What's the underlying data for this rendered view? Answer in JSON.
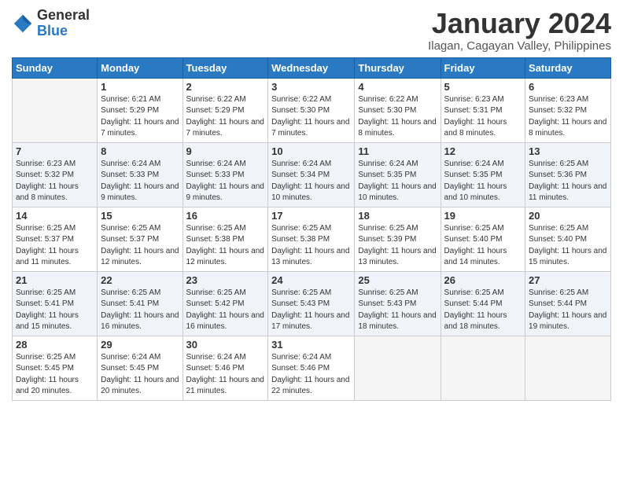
{
  "logo": {
    "general": "General",
    "blue": "Blue"
  },
  "header": {
    "month": "January 2024",
    "location": "Ilagan, Cagayan Valley, Philippines"
  },
  "weekdays": [
    "Sunday",
    "Monday",
    "Tuesday",
    "Wednesday",
    "Thursday",
    "Friday",
    "Saturday"
  ],
  "weeks": [
    [
      {
        "day": "",
        "empty": true
      },
      {
        "day": "1",
        "sunrise": "6:21 AM",
        "sunset": "5:29 PM",
        "daylight": "11 hours and 7 minutes."
      },
      {
        "day": "2",
        "sunrise": "6:22 AM",
        "sunset": "5:29 PM",
        "daylight": "11 hours and 7 minutes."
      },
      {
        "day": "3",
        "sunrise": "6:22 AM",
        "sunset": "5:30 PM",
        "daylight": "11 hours and 7 minutes."
      },
      {
        "day": "4",
        "sunrise": "6:22 AM",
        "sunset": "5:30 PM",
        "daylight": "11 hours and 8 minutes."
      },
      {
        "day": "5",
        "sunrise": "6:23 AM",
        "sunset": "5:31 PM",
        "daylight": "11 hours and 8 minutes."
      },
      {
        "day": "6",
        "sunrise": "6:23 AM",
        "sunset": "5:32 PM",
        "daylight": "11 hours and 8 minutes."
      }
    ],
    [
      {
        "day": "7",
        "sunrise": "6:23 AM",
        "sunset": "5:32 PM",
        "daylight": "11 hours and 8 minutes."
      },
      {
        "day": "8",
        "sunrise": "6:24 AM",
        "sunset": "5:33 PM",
        "daylight": "11 hours and 9 minutes."
      },
      {
        "day": "9",
        "sunrise": "6:24 AM",
        "sunset": "5:33 PM",
        "daylight": "11 hours and 9 minutes."
      },
      {
        "day": "10",
        "sunrise": "6:24 AM",
        "sunset": "5:34 PM",
        "daylight": "11 hours and 10 minutes."
      },
      {
        "day": "11",
        "sunrise": "6:24 AM",
        "sunset": "5:35 PM",
        "daylight": "11 hours and 10 minutes."
      },
      {
        "day": "12",
        "sunrise": "6:24 AM",
        "sunset": "5:35 PM",
        "daylight": "11 hours and 10 minutes."
      },
      {
        "day": "13",
        "sunrise": "6:25 AM",
        "sunset": "5:36 PM",
        "daylight": "11 hours and 11 minutes."
      }
    ],
    [
      {
        "day": "14",
        "sunrise": "6:25 AM",
        "sunset": "5:37 PM",
        "daylight": "11 hours and 11 minutes."
      },
      {
        "day": "15",
        "sunrise": "6:25 AM",
        "sunset": "5:37 PM",
        "daylight": "11 hours and 12 minutes."
      },
      {
        "day": "16",
        "sunrise": "6:25 AM",
        "sunset": "5:38 PM",
        "daylight": "11 hours and 12 minutes."
      },
      {
        "day": "17",
        "sunrise": "6:25 AM",
        "sunset": "5:38 PM",
        "daylight": "11 hours and 13 minutes."
      },
      {
        "day": "18",
        "sunrise": "6:25 AM",
        "sunset": "5:39 PM",
        "daylight": "11 hours and 13 minutes."
      },
      {
        "day": "19",
        "sunrise": "6:25 AM",
        "sunset": "5:40 PM",
        "daylight": "11 hours and 14 minutes."
      },
      {
        "day": "20",
        "sunrise": "6:25 AM",
        "sunset": "5:40 PM",
        "daylight": "11 hours and 15 minutes."
      }
    ],
    [
      {
        "day": "21",
        "sunrise": "6:25 AM",
        "sunset": "5:41 PM",
        "daylight": "11 hours and 15 minutes."
      },
      {
        "day": "22",
        "sunrise": "6:25 AM",
        "sunset": "5:41 PM",
        "daylight": "11 hours and 16 minutes."
      },
      {
        "day": "23",
        "sunrise": "6:25 AM",
        "sunset": "5:42 PM",
        "daylight": "11 hours and 16 minutes."
      },
      {
        "day": "24",
        "sunrise": "6:25 AM",
        "sunset": "5:43 PM",
        "daylight": "11 hours and 17 minutes."
      },
      {
        "day": "25",
        "sunrise": "6:25 AM",
        "sunset": "5:43 PM",
        "daylight": "11 hours and 18 minutes."
      },
      {
        "day": "26",
        "sunrise": "6:25 AM",
        "sunset": "5:44 PM",
        "daylight": "11 hours and 18 minutes."
      },
      {
        "day": "27",
        "sunrise": "6:25 AM",
        "sunset": "5:44 PM",
        "daylight": "11 hours and 19 minutes."
      }
    ],
    [
      {
        "day": "28",
        "sunrise": "6:25 AM",
        "sunset": "5:45 PM",
        "daylight": "11 hours and 20 minutes."
      },
      {
        "day": "29",
        "sunrise": "6:24 AM",
        "sunset": "5:45 PM",
        "daylight": "11 hours and 20 minutes."
      },
      {
        "day": "30",
        "sunrise": "6:24 AM",
        "sunset": "5:46 PM",
        "daylight": "11 hours and 21 minutes."
      },
      {
        "day": "31",
        "sunrise": "6:24 AM",
        "sunset": "5:46 PM",
        "daylight": "11 hours and 22 minutes."
      },
      {
        "day": "",
        "empty": true
      },
      {
        "day": "",
        "empty": true
      },
      {
        "day": "",
        "empty": true
      }
    ]
  ],
  "labels": {
    "sunrise_prefix": "Sunrise: ",
    "sunset_prefix": "Sunset: ",
    "daylight_prefix": "Daylight: "
  }
}
